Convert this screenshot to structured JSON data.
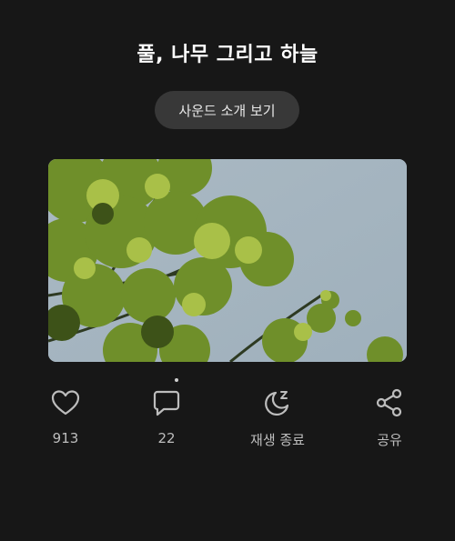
{
  "header": {
    "title": "풀, 나무 그리고 하늘"
  },
  "intro_button": {
    "label": "사운드 소개 보기"
  },
  "media": {
    "icon": "nature-photo",
    "page_indicator": "1"
  },
  "actions": {
    "like": {
      "icon": "heart-icon",
      "label": "913"
    },
    "comment": {
      "icon": "comment-icon",
      "label": "22"
    },
    "sleep_timer": {
      "icon": "moon-sleep-icon",
      "label": "재생 종료"
    },
    "share": {
      "icon": "share-icon",
      "label": "공유"
    }
  },
  "colors": {
    "background": "#171717",
    "button": "#383838",
    "icon": "#bdbdbd"
  }
}
